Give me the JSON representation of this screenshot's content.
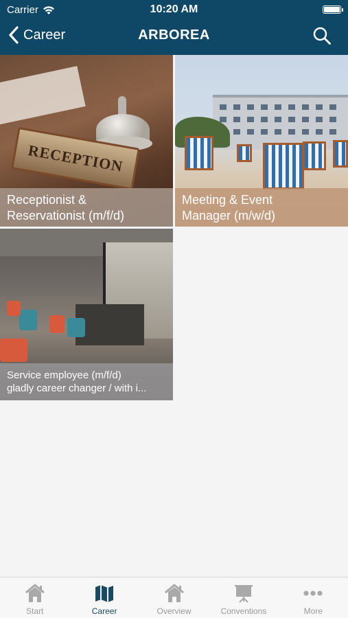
{
  "status_bar": {
    "carrier": "Carrier",
    "time": "10:20 AM"
  },
  "nav": {
    "back_label": "Career",
    "title": "ARBOREA"
  },
  "jobs": [
    {
      "line1": "Receptionist &",
      "line2": "Reservationist (m/f/d)",
      "image_text": "RECEPTION"
    },
    {
      "line1": "Meeting & Event",
      "line2": "Manager (m/w/d)"
    },
    {
      "line1": "Service employee (m/f/d)",
      "line2": "gladly career changer / with i..."
    }
  ],
  "tabs": [
    {
      "label": "Start",
      "icon": "house-icon"
    },
    {
      "label": "Career",
      "icon": "map-icon"
    },
    {
      "label": "Overview",
      "icon": "house-icon"
    },
    {
      "label": "Conventions",
      "icon": "presentation-board-icon"
    },
    {
      "label": "More",
      "icon": "more-dots-icon"
    }
  ],
  "colors": {
    "header": "#0f4866",
    "active_tab": "#1a4a63",
    "inactive_tab": "#9a9a9a"
  }
}
